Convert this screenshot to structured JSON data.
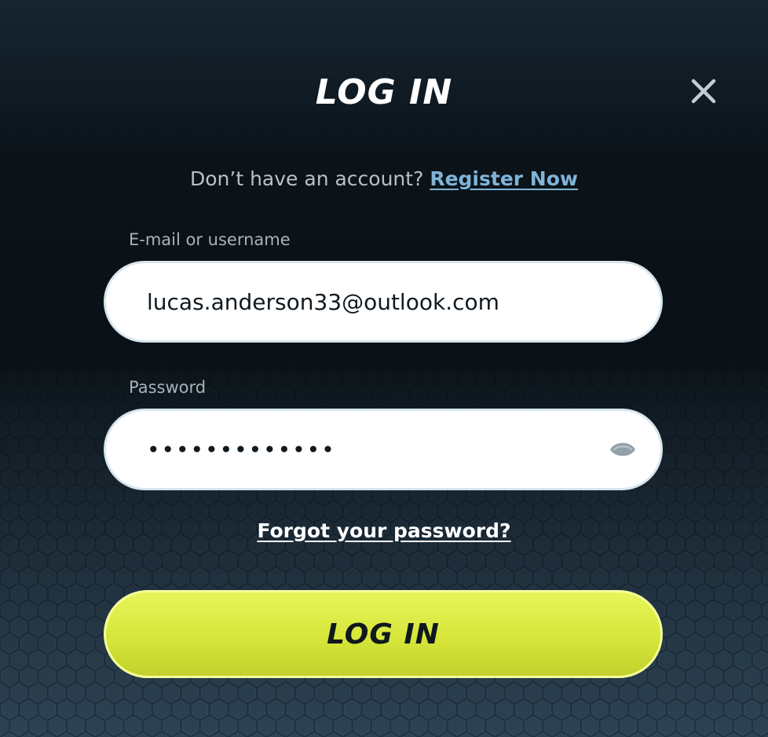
{
  "modal": {
    "title": "LOG IN",
    "close_icon": "close-icon"
  },
  "register": {
    "prompt": "Don’t have an account?",
    "link_label": "Register Now"
  },
  "form": {
    "email": {
      "label": "E-mail or username",
      "value": "lucas.anderson33@outlook.com"
    },
    "password": {
      "label": "Password",
      "value": "•••••••••••••",
      "toggle_icon": "eye-icon"
    },
    "forgot_label": "Forgot your password?",
    "submit_label": "LOG IN"
  },
  "colors": {
    "accent": "#DDEB47",
    "link": "#7FB4D9",
    "background_dark": "#0A1116",
    "field_bg": "#FFFFFF"
  }
}
